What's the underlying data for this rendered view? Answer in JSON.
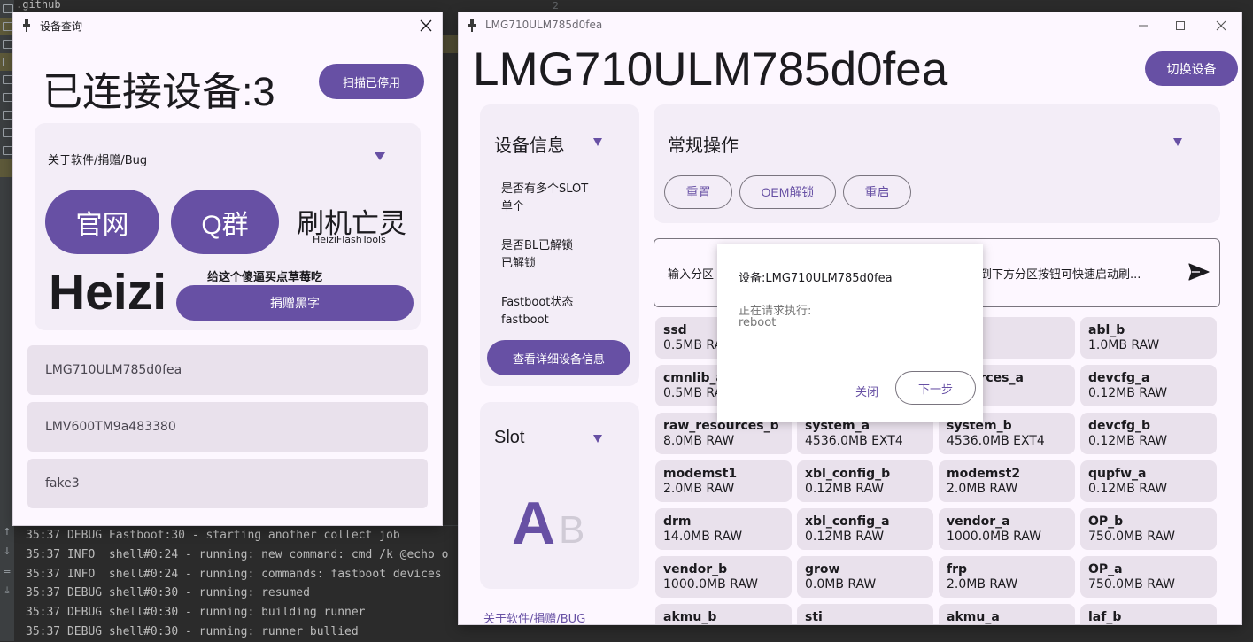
{
  "ide": {
    "folder_label": ".github",
    "line_number": "2",
    "console_lines": [
      "35:37 DEBUG Fastboot:30 - starting another collect job",
      "35:37 INFO  shell#0:24 - running: new command: cmd /k @echo o",
      "35:37 INFO  shell#0:24 - running: commands: fastboot devices",
      "35:37 DEBUG shell#0:30 - running: resumed",
      "35:37 DEBUG shell#0:30 - running: building runner",
      "35:37 DEBUG shell#0:30 - running: runner bullied"
    ]
  },
  "device_window": {
    "title": "设备查询",
    "connected_label": "已连接设备:3",
    "scan_button": "扫描已停用",
    "about_label": "关于软件/捐赠/Bug",
    "website_button": "官网",
    "qq_group_button": "Q群",
    "brand_name": "刷机亡灵",
    "brand_sub": "HeiziFlashTools",
    "author": "Heizi",
    "donate_note": "给这个傻逼买点草莓吃",
    "donate_button": "捐赠黑字",
    "devices": [
      "LMG710ULM785d0fea",
      "LMV600TM9a483380",
      "fake3"
    ]
  },
  "main_window": {
    "title_small": "LMG710ULM785d0fea",
    "title_big": "LMG710ULM785d0fea",
    "switch_button": "切换设备",
    "info": {
      "head": "设备信息",
      "items": [
        {
          "label": "是否有多个SLOT",
          "value": "单个"
        },
        {
          "label": "是否BL已解锁",
          "value": "已解锁"
        },
        {
          "label": "Fastboot状态",
          "value": "fastboot"
        }
      ],
      "detail_button": "查看详细设备信息"
    },
    "slot": {
      "head": "Slot",
      "active": "A",
      "inactive": "B"
    },
    "about_link": "关于软件/捐赠/BUG",
    "ops": {
      "head": "常规操作",
      "buttons": [
        "重置",
        "OEM解锁",
        "重启"
      ]
    },
    "input": {
      "placeholder_left": "输入分区",
      "placeholder_right": "拽到下方分区按钮可快速启动刷..."
    },
    "partitions": [
      {
        "name": "ssd",
        "size": "0.5MB RAW"
      },
      {
        "name": "",
        "size": ""
      },
      {
        "name": "",
        "size": "RAW"
      },
      {
        "name": "abl_b",
        "size": "1.0MB RAW"
      },
      {
        "name": "cmnlib_a",
        "size": "0.5MB RAW"
      },
      {
        "name": "",
        "size": ""
      },
      {
        "name": "esources_a",
        "size": "RAW"
      },
      {
        "name": "devcfg_a",
        "size": "0.12MB RAW"
      },
      {
        "name": "raw_resources_b",
        "size": "8.0MB RAW"
      },
      {
        "name": "system_a",
        "size": "4536.0MB EXT4"
      },
      {
        "name": "system_b",
        "size": "4536.0MB EXT4"
      },
      {
        "name": "devcfg_b",
        "size": "0.12MB RAW"
      },
      {
        "name": "modemst1",
        "size": "2.0MB RAW"
      },
      {
        "name": "xbl_config_b",
        "size": "0.12MB RAW"
      },
      {
        "name": "modemst2",
        "size": "2.0MB RAW"
      },
      {
        "name": "qupfw_a",
        "size": "0.12MB RAW"
      },
      {
        "name": "drm",
        "size": "14.0MB RAW"
      },
      {
        "name": "xbl_config_a",
        "size": "0.12MB RAW"
      },
      {
        "name": "vendor_a",
        "size": "1000.0MB RAW"
      },
      {
        "name": "OP_b",
        "size": "750.0MB RAW"
      },
      {
        "name": "vendor_b",
        "size": "1000.0MB RAW"
      },
      {
        "name": "grow",
        "size": "0.0MB RAW"
      },
      {
        "name": "frp",
        "size": "2.0MB RAW"
      },
      {
        "name": "OP_a",
        "size": "750.0MB RAW"
      },
      {
        "name": "akmu_b",
        "size": ""
      },
      {
        "name": "sti",
        "size": ""
      },
      {
        "name": "akmu_a",
        "size": ""
      },
      {
        "name": "laf_b",
        "size": ""
      }
    ]
  },
  "dialog": {
    "title": "设备:LMG710ULM785d0fea",
    "line1": "正在请求执行:",
    "line2": "reboot",
    "close_button": "关闭",
    "next_button": "下一步"
  },
  "colors": {
    "accent": "#6750a4",
    "surface": "#fdf7ff",
    "card": "#f3edf7",
    "chip": "#e9e1ec"
  }
}
